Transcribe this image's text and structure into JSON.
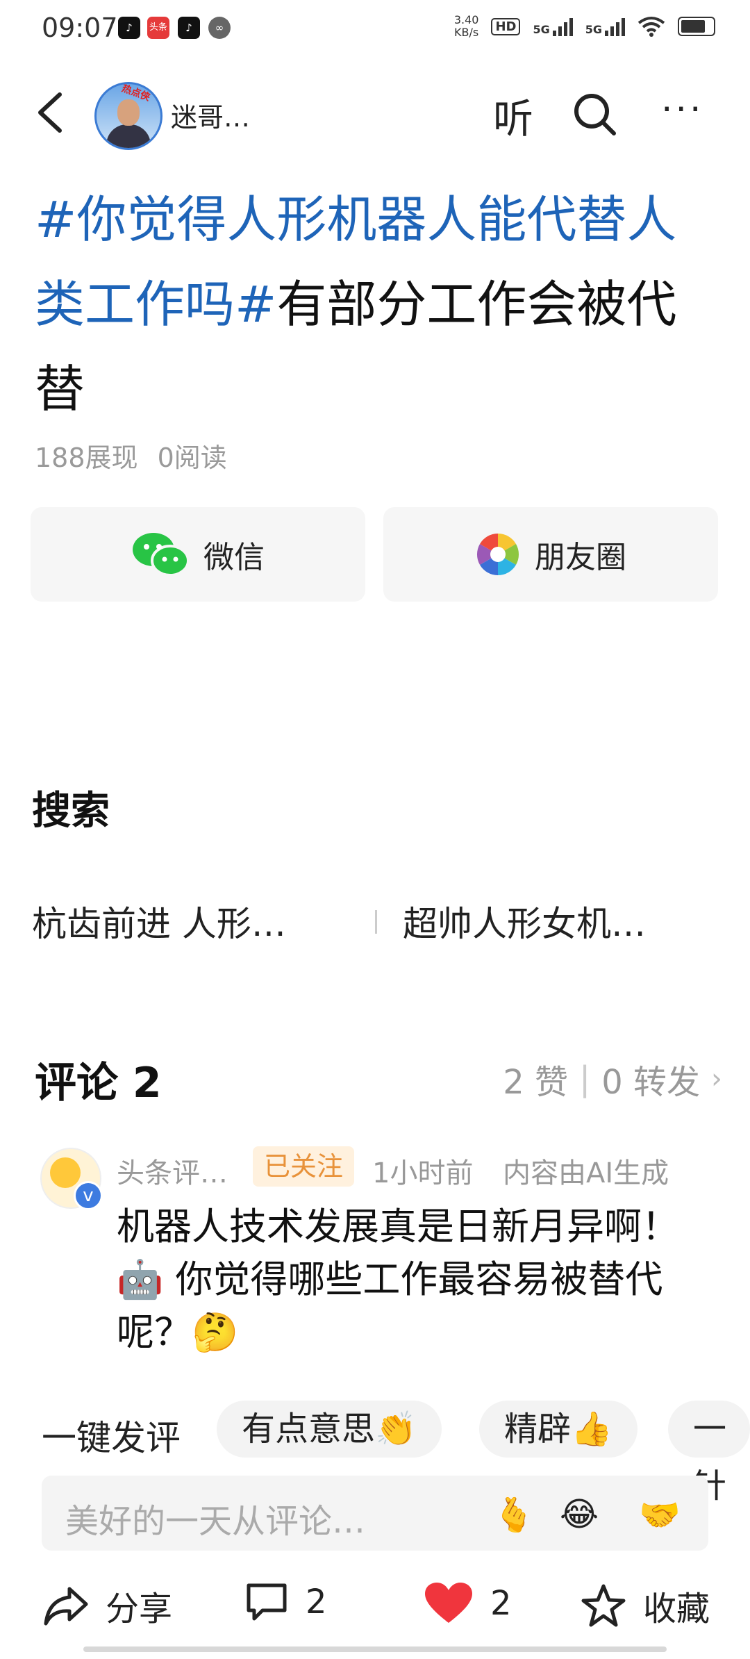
{
  "status_bar": {
    "time": "09:07",
    "app_badges": [
      "抖音",
      "头条",
      "抖音",
      "链接"
    ],
    "net_speed_top": "3.40",
    "net_speed_bottom": "KB/s",
    "hd": "HD",
    "sim1": "5G",
    "sim2": "5G"
  },
  "header": {
    "back_icon": "chevron-left-icon",
    "author_name": "迷哥…",
    "avatar_badge": "热点侠",
    "listen_label": "听",
    "search_icon": "search-icon",
    "more_icon": "more-horizontal-icon"
  },
  "article": {
    "title_tag": "#你觉得人形机器人能代替人类工作吗#",
    "title_rest": "有部分工作会被代替",
    "views": "188展现",
    "reads": "0阅读"
  },
  "share": {
    "wechat_label": "微信",
    "moments_label": "朋友圈"
  },
  "search_section": {
    "heading": "搜索",
    "suggestions": [
      "杭齿前进 人形…",
      "超帅人形女机…"
    ]
  },
  "comments": {
    "heading": "评论 2",
    "likes": "2 赞",
    "separator": "|",
    "reposts": "0 转发",
    "items": [
      {
        "name": "头条评…",
        "follow_status": "已关注",
        "time": "1小时前",
        "ai_note": "内容由AI生成",
        "text": "机器人技术发展真是日新月异啊！🤖 你觉得哪些工作最容易被替代呢？🤔"
      }
    ]
  },
  "quick_comment": {
    "label": "一键发评",
    "chips": [
      "有点意思👏",
      "精辟👍",
      "一针"
    ]
  },
  "input": {
    "placeholder": "美好的一天从评论…",
    "emojis": [
      "🫰",
      "😂",
      "🤝"
    ]
  },
  "bottom_bar": {
    "share_label": "分享",
    "comment_count": "2",
    "like_count": "2",
    "favorite_label": "收藏"
  },
  "colors": {
    "topic_blue": "#1e64b8",
    "like_red": "#f0353d",
    "follow_orange": "#e8923a"
  }
}
